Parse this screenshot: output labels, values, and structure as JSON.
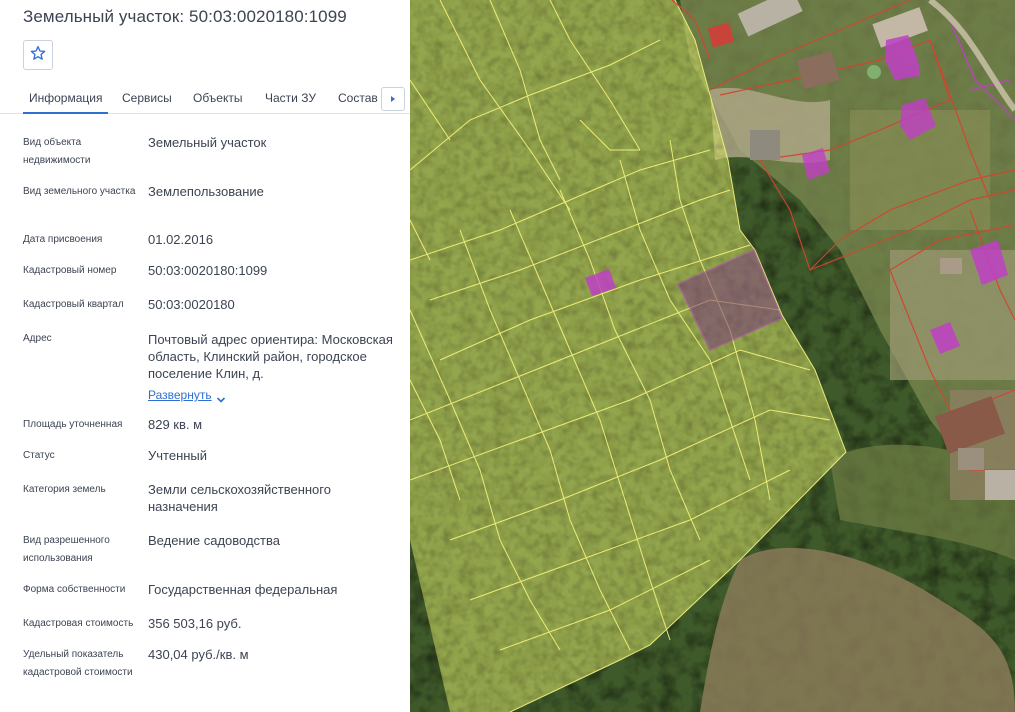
{
  "header": {
    "title": "Земельный участок: 50:03:0020180:1099",
    "favorite_icon": "star-outline-icon"
  },
  "tabs": [
    {
      "label": "Информация",
      "active": true
    },
    {
      "label": "Сервисы",
      "active": false
    },
    {
      "label": "Объекты",
      "active": false
    },
    {
      "label": "Части ЗУ",
      "active": false
    },
    {
      "label": "Состав ЕЗП",
      "active": false
    }
  ],
  "tabs_next_icon": "caret-right-icon",
  "details": [
    {
      "label": "Вид объекта недвижимости",
      "value": "Земельный участок"
    },
    {
      "label": "Вид земельного участка",
      "value": "Землепользование"
    },
    {
      "label": "Дата присвоения",
      "value": "01.02.2016"
    },
    {
      "label": "Кадастровый номер",
      "value": "50:03:0020180:1099"
    },
    {
      "label": "Кадастровый квартал",
      "value": "50:03:0020180"
    },
    {
      "label": "Адрес",
      "value": "Почтовый адрес ориентира: Московская область, Клинский район, городское поселение Клин, д."
    },
    {
      "label": "Площадь уточненная",
      "value": "829 кв. м"
    },
    {
      "label": "Статус",
      "value": "Учтенный"
    },
    {
      "label": "Категория земель",
      "value": "Земли сельскохозяйственного назначения"
    },
    {
      "label": "Вид разрешенного использования",
      "value": "Ведение садоводства"
    },
    {
      "label": "Форма собственности",
      "value": "Государственная федеральная"
    },
    {
      "label": "Кадастровая стоимость",
      "value": "356 503,16 руб."
    },
    {
      "label": "Удельный показатель кадастровой стоимости",
      "value": "430,04 руб./кв. м"
    }
  ],
  "address_expand": {
    "label": "Развернуть",
    "icon": "chevron-down-icon"
  },
  "colors": {
    "accent": "#2f6fd0",
    "parcel_fill": "#d9e66a",
    "parcel_stroke": "#f2f07a",
    "selected_parcel": "#8a3c8c",
    "building": "#c03fc6",
    "boundary_red": "#d2452f"
  }
}
